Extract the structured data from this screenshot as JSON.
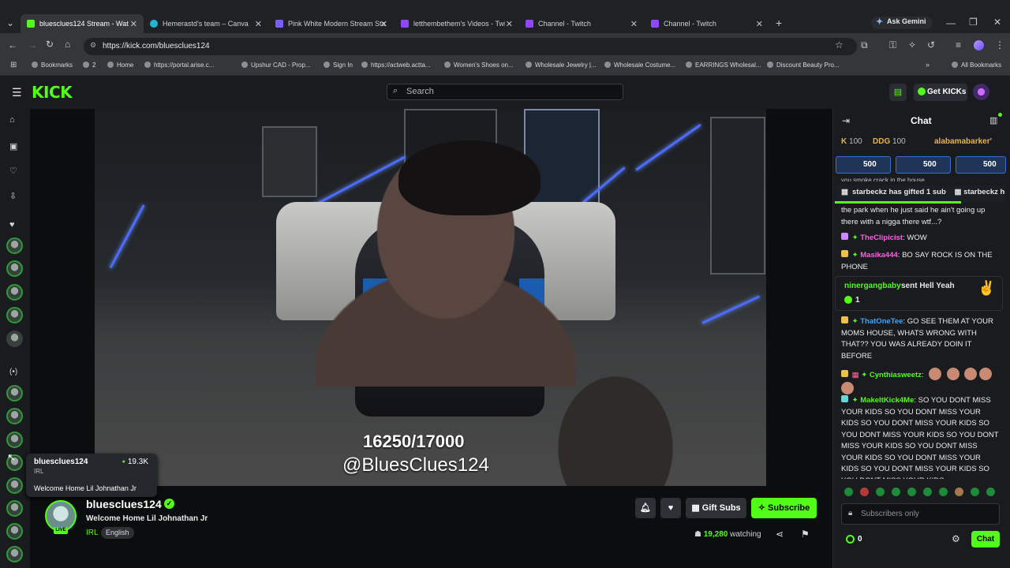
{
  "browser": {
    "tabs": [
      {
        "label": "bluesclues124 Stream - Wat",
        "favicon_color": "#53fc18",
        "active": true
      },
      {
        "label": "Hemerastd's team – Canva",
        "favicon_color": "#21b6d8"
      },
      {
        "label": "Pink White Modern Stream Star",
        "favicon_color": "#7b5cff"
      },
      {
        "label": "letthembethem's Videos - Twitc",
        "favicon_color": "#9146ff"
      },
      {
        "label": "Channel - Twitch",
        "favicon_color": "#9146ff"
      },
      {
        "label": "Channel - Twitch",
        "favicon_color": "#9146ff"
      }
    ],
    "ask_gemini": "Ask Gemini",
    "url": "https://kick.com/bluesclues124",
    "bookmarks": [
      "Bookmarks",
      "2",
      "Home",
      "https://portal.arise.c...",
      "Upshur CAD - Prop...",
      "Sign In",
      "https://actweb.actta...",
      "Women's Shoes on...",
      "Wholesale Jewelry |...",
      "Wholesale Costume...",
      "EARRINGS Wholesal...",
      "Discount Beauty Pro...",
      "All Bookmarks"
    ]
  },
  "kick": {
    "logo": "KICK",
    "search_placeholder": "Search",
    "get_kicks": "Get KICKs"
  },
  "video": {
    "overlay_count": "16250/17000",
    "overlay_handle": "@BluesClues124"
  },
  "tooltip": {
    "name": "bluesclues124",
    "category": "IRL",
    "viewers": "19.3K",
    "title": "Welcome Home Lil Johnathan Jr"
  },
  "stream": {
    "name": "bluesclues124",
    "title": "Welcome Home Lil Johnathan Jr",
    "category": "IRL",
    "language": "English",
    "live": "LIVE",
    "gift_subs": "Gift Subs",
    "subscribe": "Subscribe",
    "watching_count": "19,280",
    "watching_label": "watching"
  },
  "chat": {
    "title": "Chat",
    "leaderboard": [
      {
        "name": "K",
        "score": "100"
      },
      {
        "name": "DDG",
        "score": "100"
      },
      {
        "name": "alabamabarker'",
        "score": ""
      }
    ],
    "pinned": [
      "500",
      "500",
      "500"
    ],
    "gift_banner": "starbeckz has gifted 1 sub",
    "gift_banner_2": "starbeckz h",
    "clipped_top": "you smoke crack in the house",
    "messages": [
      {
        "user": "",
        "text": "the park when he just said he ain't going up there with a nigga there wtf...?",
        "color": "#ffffff"
      },
      {
        "user": "TheClipicist",
        "text": ": WOW",
        "color": "#ff5fe2"
      },
      {
        "user": "Masika444",
        "text": ": BO SAY ROCK IS ON THE PHONE",
        "color": "#ff5fe2"
      },
      {
        "user": "ThatOneTee",
        "text": ": GO SEE THEM AT YOUR MOMS HOUSE, WHATS WRONG WITH THAT?? YOU WAS ALREADY DOIN IT BEFORE",
        "color": "#3ba5ff"
      },
      {
        "user": "Cynthiasweetz",
        "text": ":",
        "color": "#53fc18"
      },
      {
        "user": "MakeItKick4Me",
        "text": ": SO YOU DONT MISS YOUR KIDS SO YOU DONT MISS YOUR KIDS SO YOU DONT MISS YOUR KIDS SO YOU DONT MISS YOUR KIDS SO YOU DONT MISS YOUR KIDS SO YOU DONT MISS YOUR KIDS SO YOU DONT MISS YOUR KIDS SO YOU DONT MISS YOUR KIDS SO YOU DONT MISS YOUR KIDS",
        "color": "#53fc18"
      }
    ],
    "gift_event": {
      "user": "ninergangbaby",
      "text": "sent Hell Yeah",
      "count": "1"
    },
    "input_placeholder": "Subscribers only",
    "kicks_count": "0",
    "chat_button": "Chat"
  },
  "colors": {
    "accent": "#53fc18",
    "background": "#0b0e0f",
    "panel": "#191b1f"
  }
}
